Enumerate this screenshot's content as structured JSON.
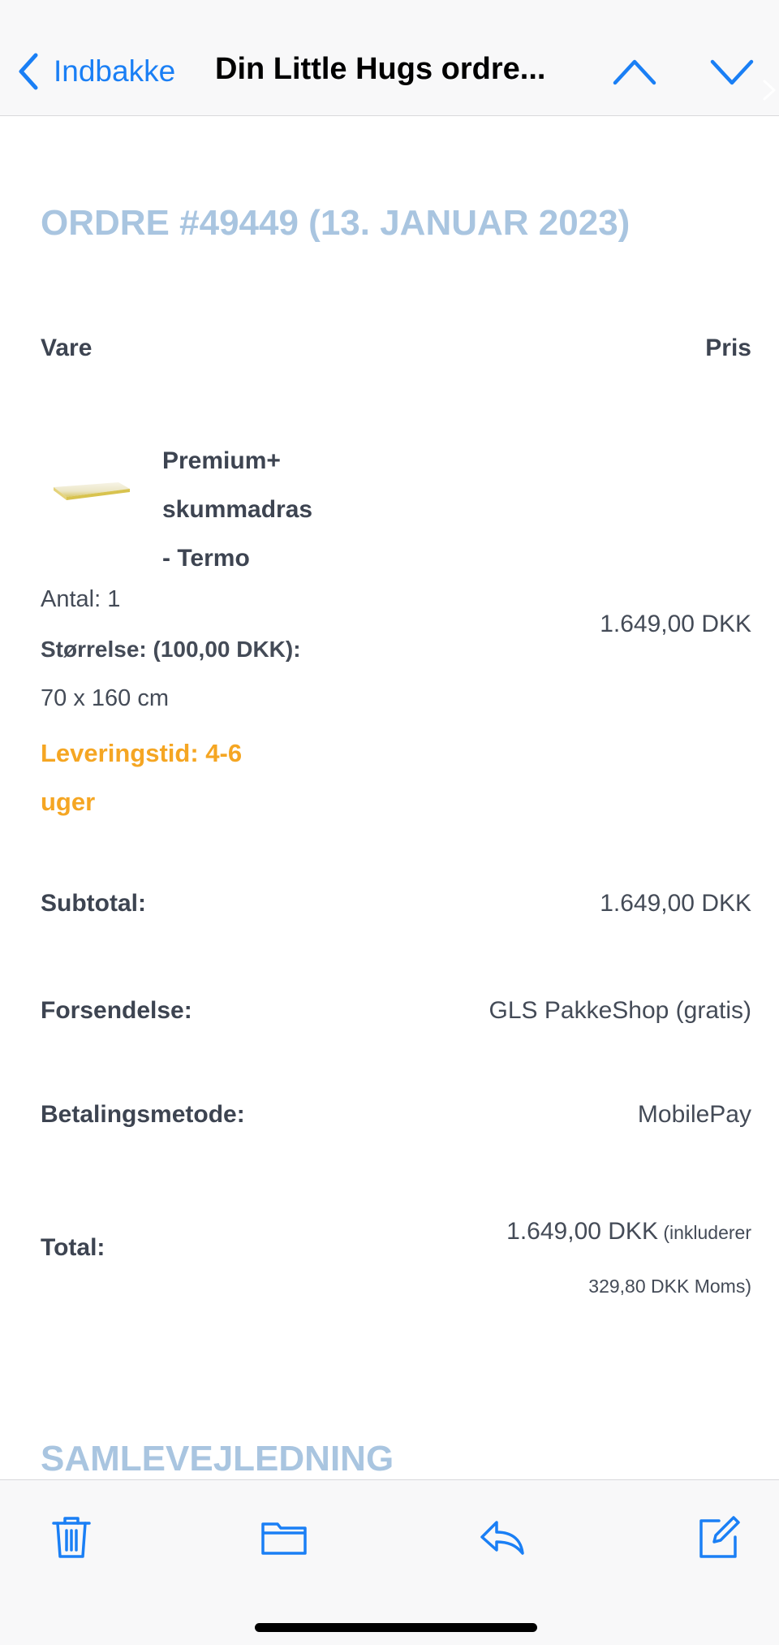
{
  "nav": {
    "back_label": "Indbakke",
    "title": "Din Little Hugs ordre...",
    "accent_color": "#1a7ff5"
  },
  "order": {
    "heading": "ORDRE #49449 (13. JANUAR 2023)",
    "col_item": "Vare",
    "col_price": "Pris"
  },
  "item": {
    "name_line1": "Premium+",
    "name_line2": "skummadras",
    "name_line3": "- Termo",
    "quantity": "Antal: 1",
    "size_label": "Størrelse: (100,00 DKK):",
    "size_value": "70 x 160 cm",
    "delivery_line1": "Leveringstid: 4-6",
    "delivery_line2": "uger",
    "price": "1.649,00 DKK"
  },
  "summary": {
    "subtotal_label": "Subtotal:",
    "subtotal_value": "1.649,00 DKK",
    "shipping_label": "Forsendelse:",
    "shipping_value": "GLS PakkeShop (gratis)",
    "payment_label": "Betalingsmetode:",
    "payment_value": "MobilePay",
    "total_label": "Total:",
    "total_amount": "1.649,00 DKK",
    "total_note_1": " (inkluderer",
    "total_note_2": "329,80 DKK Moms)"
  },
  "section": {
    "heading": "SAMLEVEJLEDNING"
  },
  "toolbar": {
    "icons": [
      "trash-icon",
      "folder-icon",
      "reply-icon",
      "compose-icon"
    ]
  },
  "colors": {
    "heading": "#a9c5e0",
    "delivery": "#f5a623",
    "text": "#3d4451"
  }
}
